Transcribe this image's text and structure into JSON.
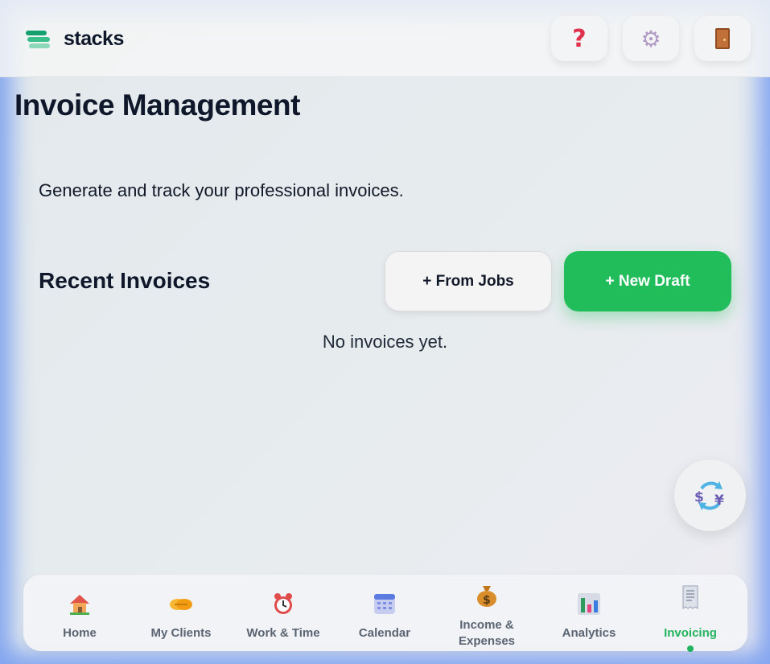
{
  "app": {
    "name": "stacks"
  },
  "header": {
    "help_icon": "question-icon",
    "settings_icon": "gear-icon",
    "logout_icon": "door-icon"
  },
  "main": {
    "title": "Invoice Management",
    "subtitle": "Generate and track your professional invoices.",
    "section_title": "Recent Invoices",
    "from_jobs_label": "+ From Jobs",
    "new_draft_label": "+ New Draft",
    "empty_text": "No invoices yet."
  },
  "fab": {
    "icon": "currency-exchange-icon"
  },
  "nav": {
    "items": [
      {
        "label": "Home",
        "icon": "house-icon"
      },
      {
        "label": "My Clients",
        "icon": "handshake-icon"
      },
      {
        "label": "Work & Time",
        "icon": "alarm-clock-icon"
      },
      {
        "label": "Calendar",
        "icon": "calendar-icon"
      },
      {
        "label": "Income &",
        "label2": "Expenses",
        "icon": "money-bag-icon"
      },
      {
        "label": "Analytics",
        "icon": "bar-chart-icon"
      },
      {
        "label": "Invoicing",
        "icon": "receipt-icon",
        "active": true
      }
    ]
  },
  "colors": {
    "accent": "#22bd5b",
    "title": "#0f172a",
    "nav_label": "#5b6472",
    "frame_glow": "#7fa6ee"
  }
}
